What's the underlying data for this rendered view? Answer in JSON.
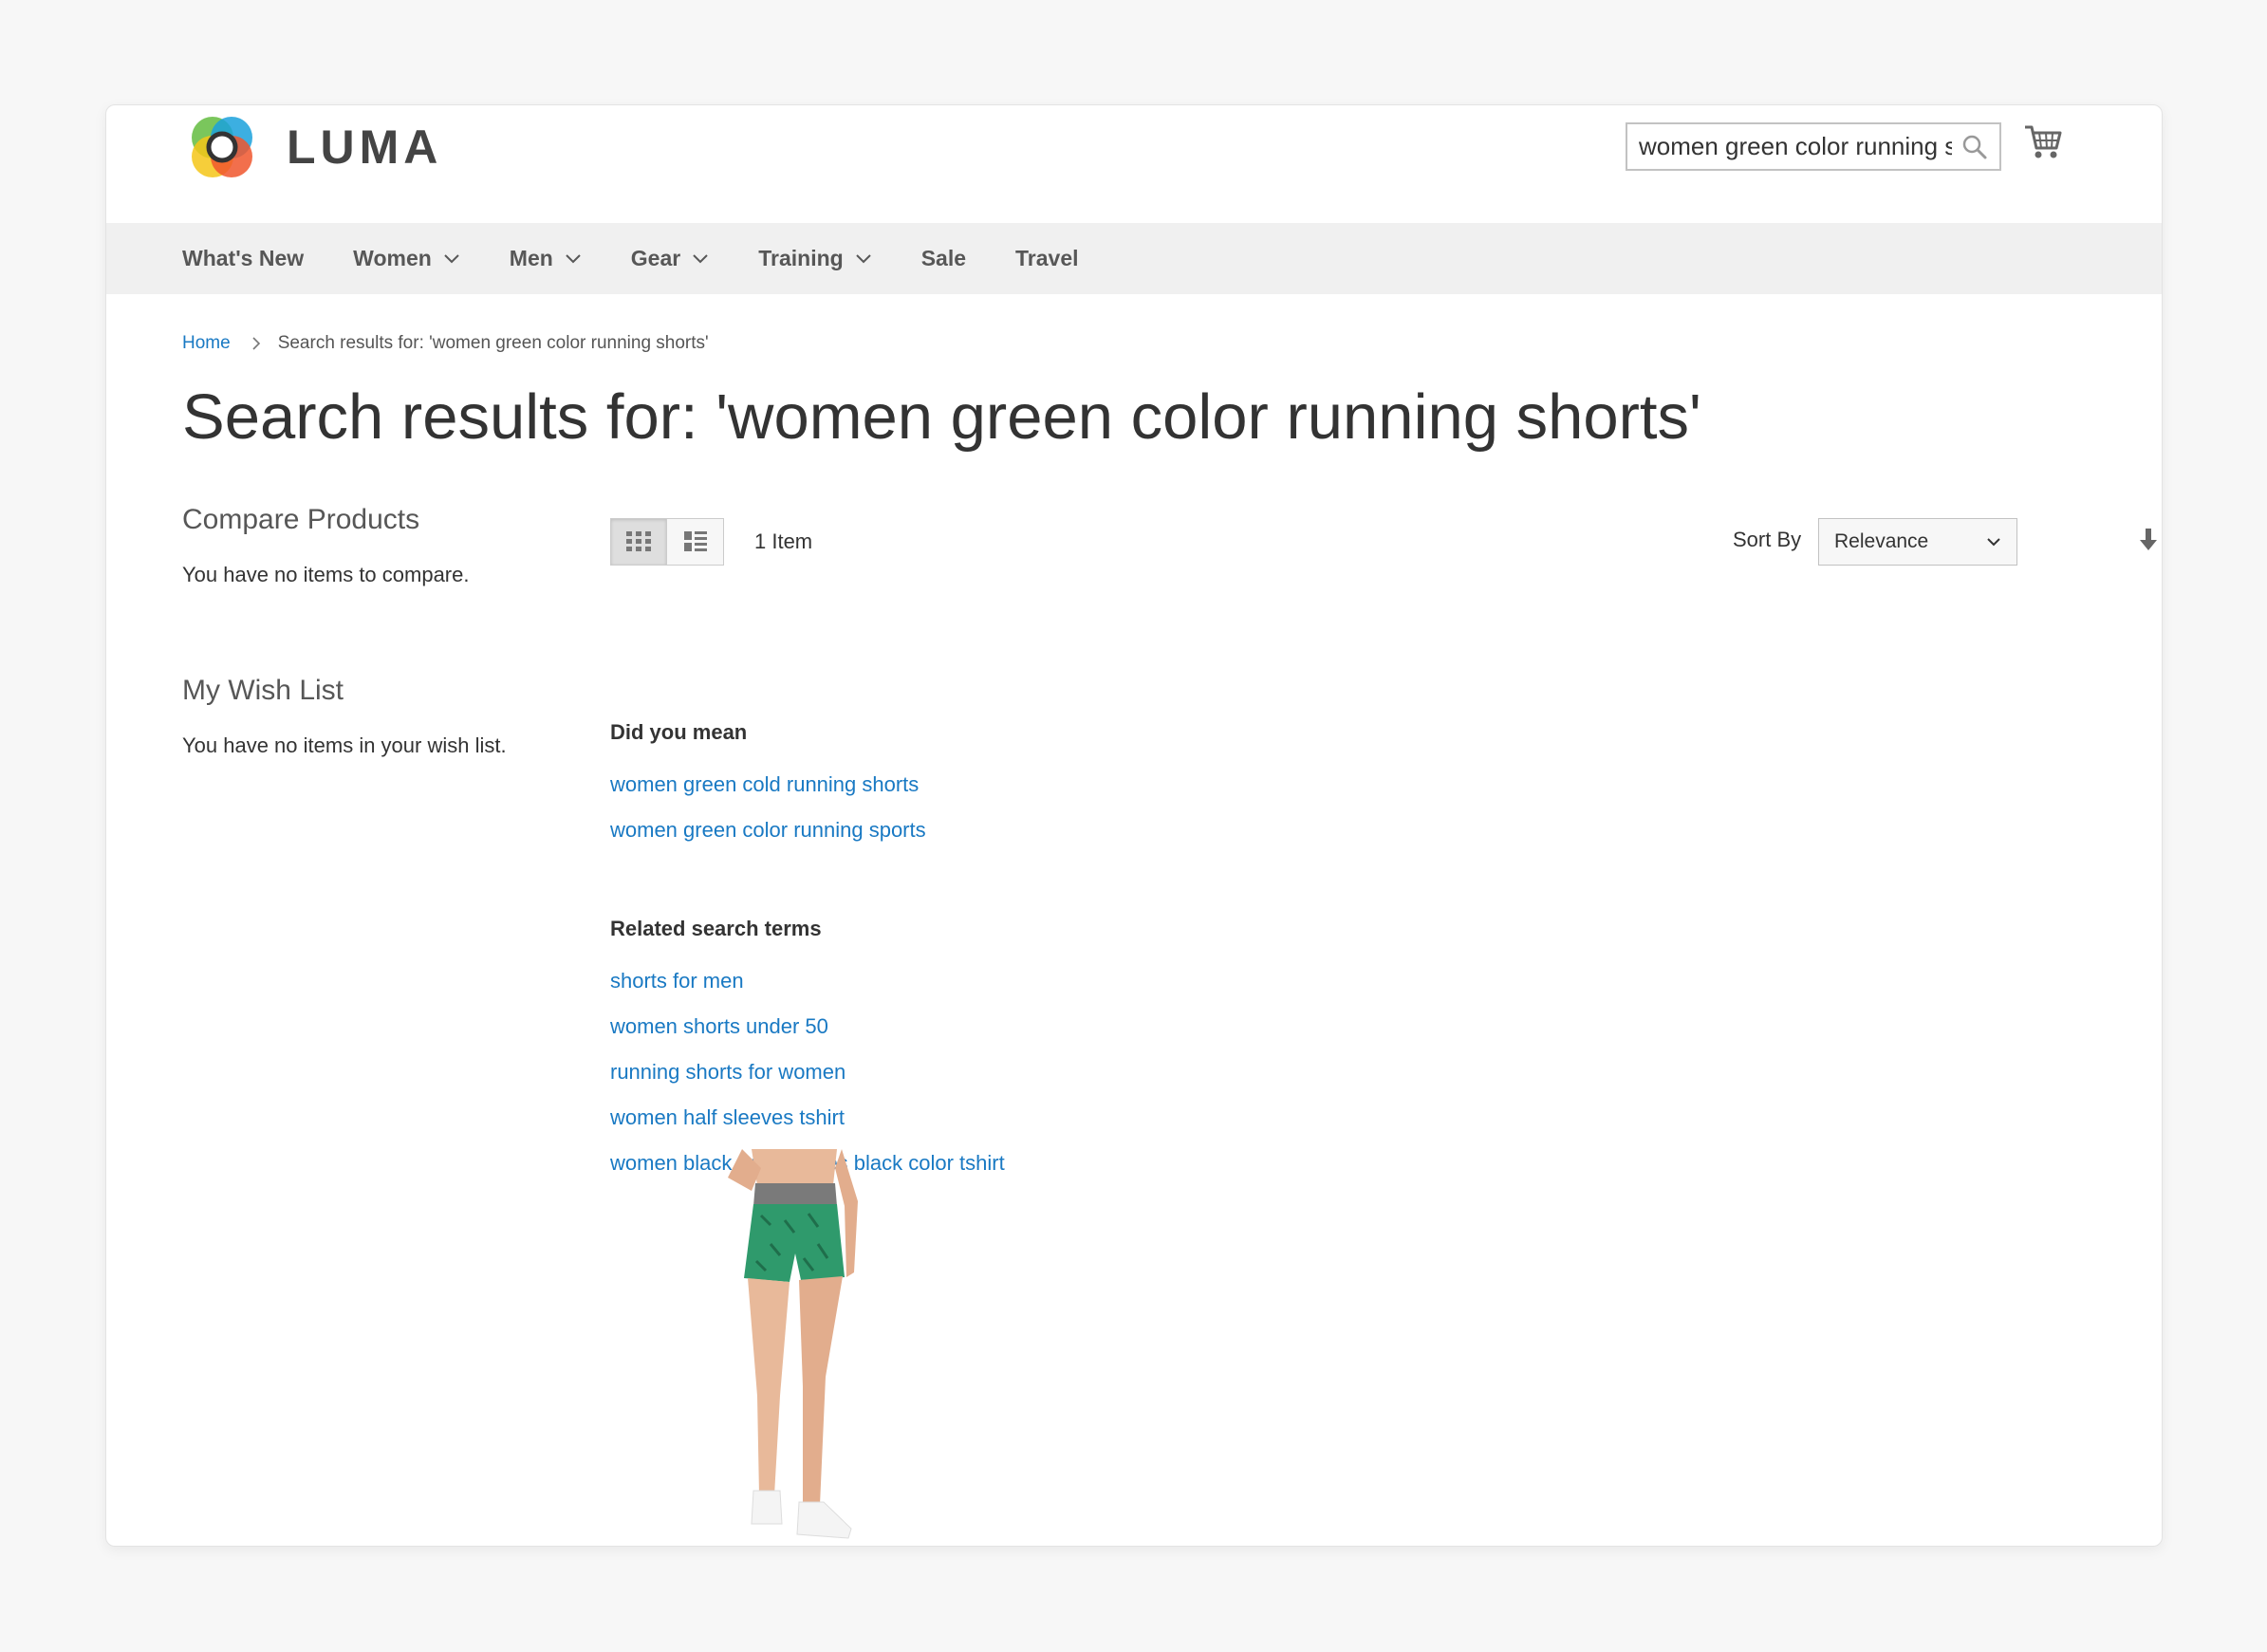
{
  "header": {
    "logo_text": "LUMA",
    "search_value": "women green color running shorts",
    "brand_colors": {
      "link": "#1979c3",
      "nav_bg": "#f0f0f0"
    }
  },
  "nav": {
    "items": [
      {
        "label": "What's New",
        "has_dropdown": false
      },
      {
        "label": "Women",
        "has_dropdown": true
      },
      {
        "label": "Men",
        "has_dropdown": true
      },
      {
        "label": "Gear",
        "has_dropdown": true
      },
      {
        "label": "Training",
        "has_dropdown": true
      },
      {
        "label": "Sale",
        "has_dropdown": false
      },
      {
        "label": "Travel",
        "has_dropdown": false
      }
    ]
  },
  "breadcrumb": {
    "home": "Home",
    "current": "Search results for: 'women green color running shorts'"
  },
  "page_title": "Search results for: 'women green color running shorts'",
  "sidebar": {
    "compare_title": "Compare Products",
    "compare_text": "You have no items to compare.",
    "wishlist_title": "My Wish List",
    "wishlist_text": "You have no items in your wish list."
  },
  "toolbar": {
    "item_count": "1 Item",
    "sort_label": "Sort By",
    "sort_value": "Relevance",
    "view_modes": [
      "grid-icon",
      "list-icon"
    ],
    "active_mode": "grid"
  },
  "did_you_mean": {
    "title": "Did you mean",
    "items": [
      "women green cold running shorts",
      "women green color running sports"
    ]
  },
  "related": {
    "title": "Related search terms",
    "items": [
      "shorts for men",
      "women shorts under 50",
      "running shorts for women",
      "women half sleeves tshirt",
      "women black half sleeves black color tshirt"
    ]
  }
}
